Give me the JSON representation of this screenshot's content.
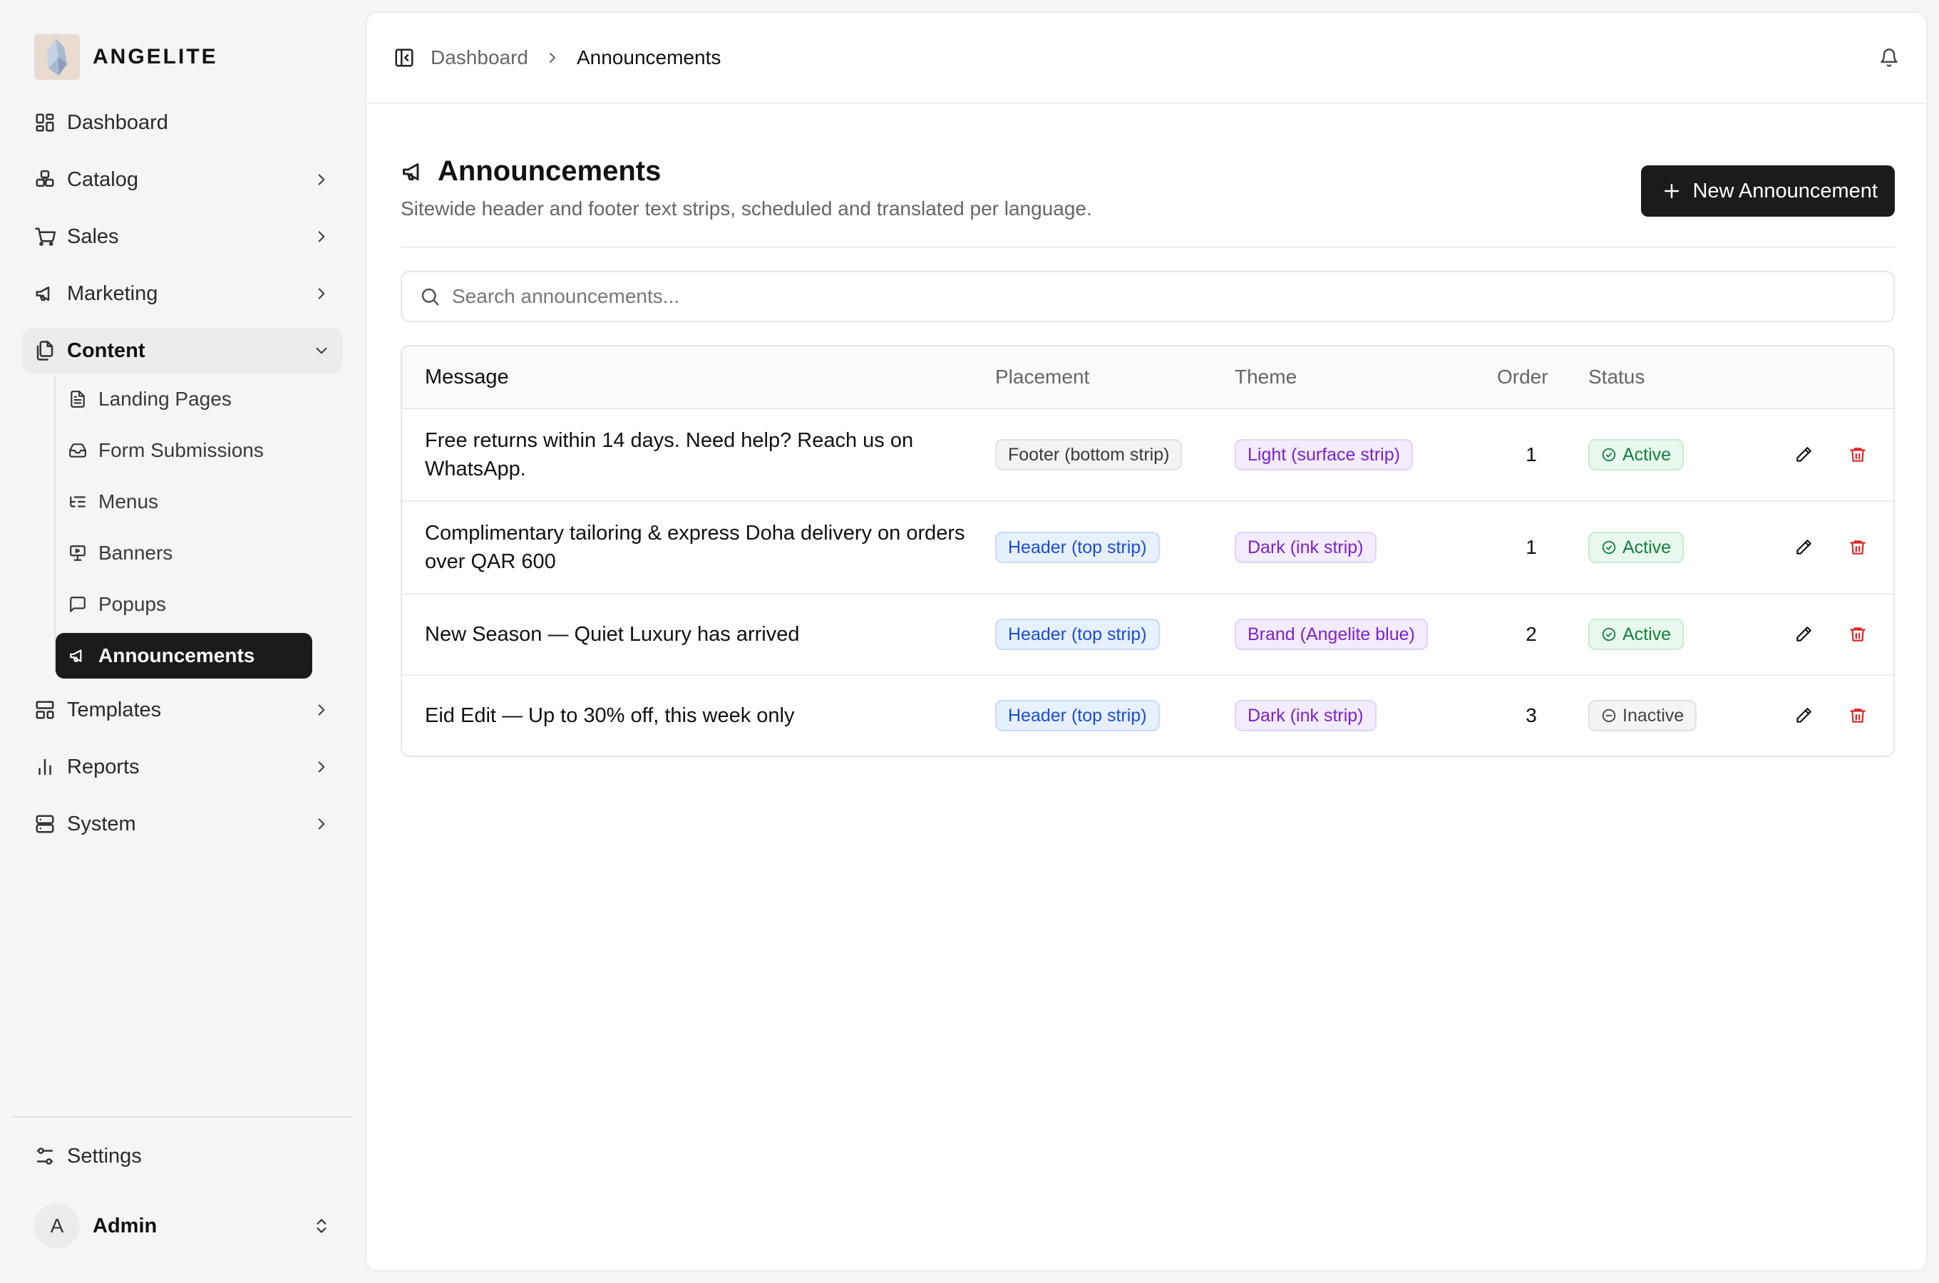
{
  "brand": {
    "name": "ANGELITE"
  },
  "sidebar": {
    "items": [
      {
        "label": "Dashboard",
        "icon": "dashboard-icon"
      },
      {
        "label": "Catalog",
        "icon": "catalog-icon"
      },
      {
        "label": "Sales",
        "icon": "cart-icon"
      },
      {
        "label": "Marketing",
        "icon": "megaphone-icon"
      },
      {
        "label": "Content",
        "icon": "files-icon"
      },
      {
        "label": "Templates",
        "icon": "templates-icon"
      },
      {
        "label": "Reports",
        "icon": "bar-chart-icon"
      },
      {
        "label": "System",
        "icon": "server-icon"
      }
    ],
    "content_sub": [
      {
        "label": "Landing Pages",
        "icon": "file-text-icon"
      },
      {
        "label": "Form Submissions",
        "icon": "inbox-icon"
      },
      {
        "label": "Menus",
        "icon": "list-tree-icon"
      },
      {
        "label": "Banners",
        "icon": "presentation-icon"
      },
      {
        "label": "Popups",
        "icon": "message-square-icon"
      },
      {
        "label": "Announcements",
        "icon": "megaphone-icon"
      }
    ],
    "settings": "Settings",
    "user": {
      "initial": "A",
      "name": "Admin"
    }
  },
  "breadcrumb": {
    "parent": "Dashboard",
    "current": "Announcements"
  },
  "page": {
    "title": "Announcements",
    "subtitle": "Sitewide header and footer text strips, scheduled and translated per language.",
    "new_button": "New Announcement"
  },
  "search": {
    "placeholder": "Search announcements..."
  },
  "table": {
    "headers": {
      "message": "Message",
      "placement": "Placement",
      "theme": "Theme",
      "order": "Order",
      "status": "Status"
    },
    "rows": [
      {
        "message": "Free returns within 14 days. Need help? Reach us on WhatsApp.",
        "placement": "Footer (bottom strip)",
        "theme": "Light (surface strip)",
        "order": "1",
        "status": "Active"
      },
      {
        "message": "Complimentary tailoring & express Doha delivery on orders over QAR 600",
        "placement": "Header (top strip)",
        "theme": "Dark (ink strip)",
        "order": "1",
        "status": "Active"
      },
      {
        "message": "New Season — Quiet Luxury has arrived",
        "placement": "Header (top strip)",
        "theme": "Brand (Angelite blue)",
        "order": "2",
        "status": "Active"
      },
      {
        "message": "Eid Edit — Up to 30% off, this week only",
        "placement": "Header (top strip)",
        "theme": "Dark (ink strip)",
        "order": "3",
        "status": "Inactive"
      }
    ]
  },
  "colors": {
    "accent": "#1b1b1b",
    "active_green": "#15803d",
    "header_blue": "#1d4ed8",
    "theme_purple": "#7e22ce",
    "delete_red": "#dc2626"
  }
}
